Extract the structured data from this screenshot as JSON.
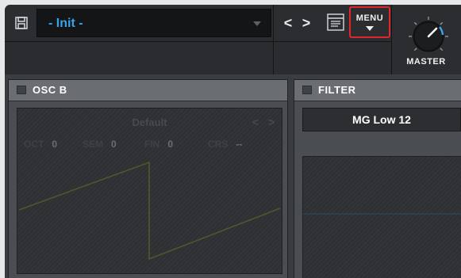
{
  "toolbar": {
    "preset_name": "- Init -",
    "menu_label": "MENU",
    "master_label": "MASTER",
    "prev_glyph": "<",
    "next_glyph": ">"
  },
  "osc_b": {
    "title": "OSC B",
    "waveform_name": "Default",
    "params": [
      {
        "label": "OCT",
        "value": "0"
      },
      {
        "label": "SEM",
        "value": "0"
      },
      {
        "label": "FIN",
        "value": "0"
      },
      {
        "label": "CRS",
        "value": "--"
      }
    ]
  },
  "filter": {
    "title": "FILTER",
    "type": "MG Low 12"
  },
  "colors": {
    "accent": "#3aa3e8",
    "menu_highlight": "#e0262a",
    "waveform": "#4a5a2e"
  },
  "icons": [
    "save-icon",
    "chevron-left-icon",
    "chevron-right-icon",
    "preset-browser-icon",
    "caret-down-icon",
    "master-knob"
  ]
}
